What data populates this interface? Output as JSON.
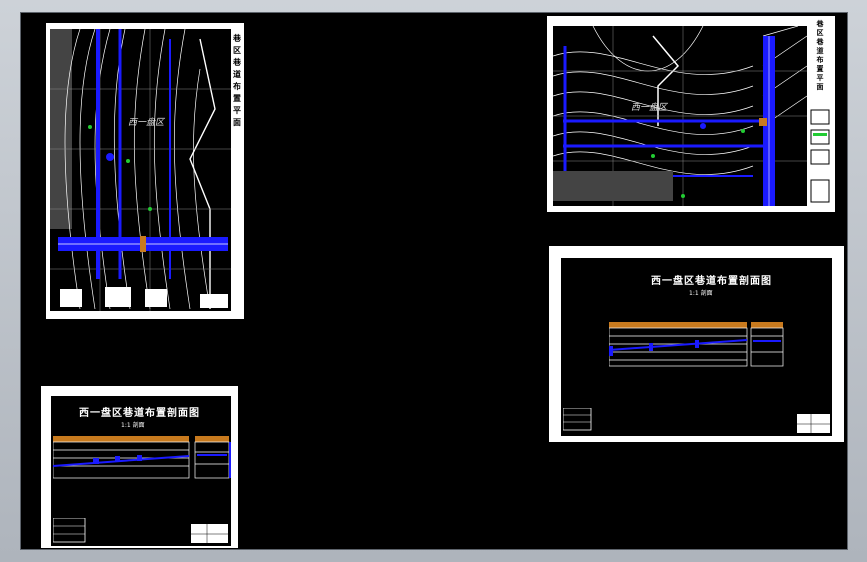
{
  "viewport": {
    "name": "model-space"
  },
  "sheets": {
    "plan_large": {
      "label": "西一盘区",
      "side_text": [
        "巷",
        "区",
        "巷",
        "道",
        "布",
        "置",
        "平",
        "面"
      ]
    },
    "plan_right": {
      "label": "西一盘区",
      "side_text": [
        "巷",
        "区",
        "巷",
        "道",
        "布",
        "置",
        "平",
        "面"
      ]
    },
    "section_right": {
      "title": "西一盘区巷道布置剖面图",
      "subtitle": "1:1 剖面"
    },
    "section_left": {
      "title": "西一盘区巷道布置剖面图",
      "subtitle": "1:1 剖面"
    }
  },
  "colors": {
    "sheet": "#ffffff",
    "drawing_bg": "#000000",
    "contour": "#ffffff",
    "roadway": "#1a1aff",
    "coal": "#c87a1e",
    "marker": "#22cc33"
  }
}
